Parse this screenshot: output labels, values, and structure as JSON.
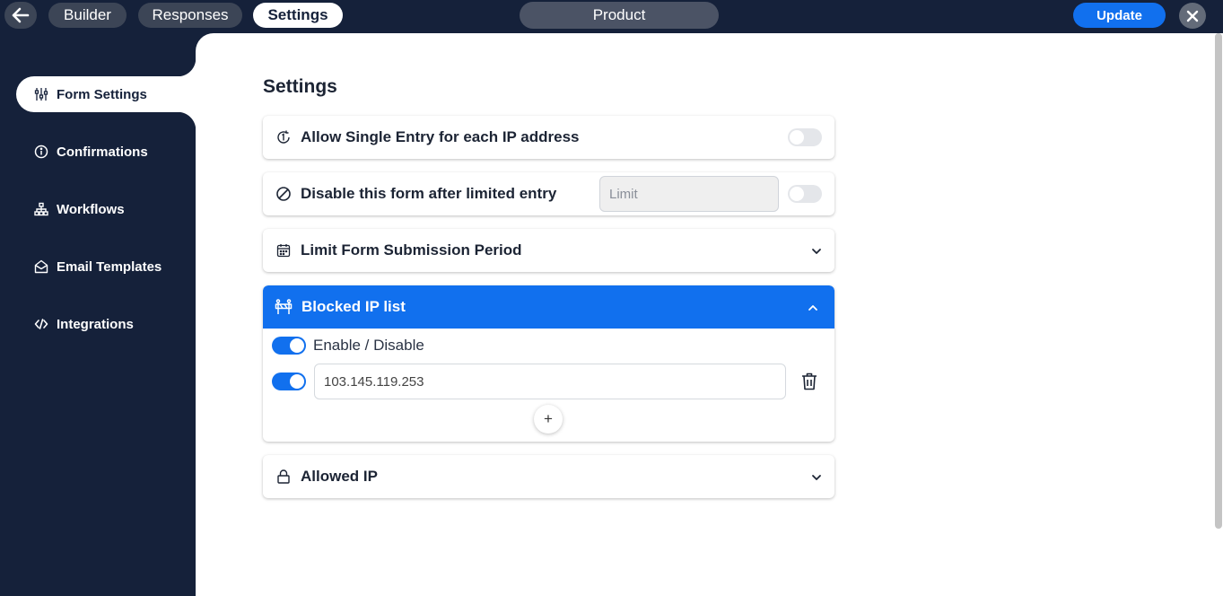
{
  "topbar": {
    "tabs": [
      {
        "label": "Builder"
      },
      {
        "label": "Responses"
      },
      {
        "label": "Settings"
      }
    ],
    "product_title": "Product",
    "update_label": "Update"
  },
  "sidebar": {
    "items": [
      {
        "label": "Form Settings",
        "icon": "sliders-icon",
        "active": true
      },
      {
        "label": "Confirmations",
        "icon": "info-icon"
      },
      {
        "label": "Workflows",
        "icon": "sitemap-icon"
      },
      {
        "label": "Email Templates",
        "icon": "envelope-open-icon"
      },
      {
        "label": "Integrations",
        "icon": "code-icon"
      }
    ]
  },
  "main": {
    "title": "Settings",
    "single_entry": {
      "label": "Allow Single Entry for each IP address",
      "enabled": false
    },
    "limited_entry": {
      "label": "Disable this form after limited entry",
      "placeholder": "Limit",
      "enabled": false
    },
    "submission_period": {
      "label": "Limit Form Submission Period"
    },
    "blocked_ip": {
      "label": "Blocked IP list",
      "enable_label": "Enable / Disable",
      "enabled": true,
      "entries": [
        {
          "ip": "103.145.119.253",
          "enabled": true
        }
      ],
      "add_label": "+"
    },
    "allowed_ip": {
      "label": "Allowed IP"
    }
  },
  "colors": {
    "navy": "#15213a",
    "accent": "#1170ee"
  }
}
